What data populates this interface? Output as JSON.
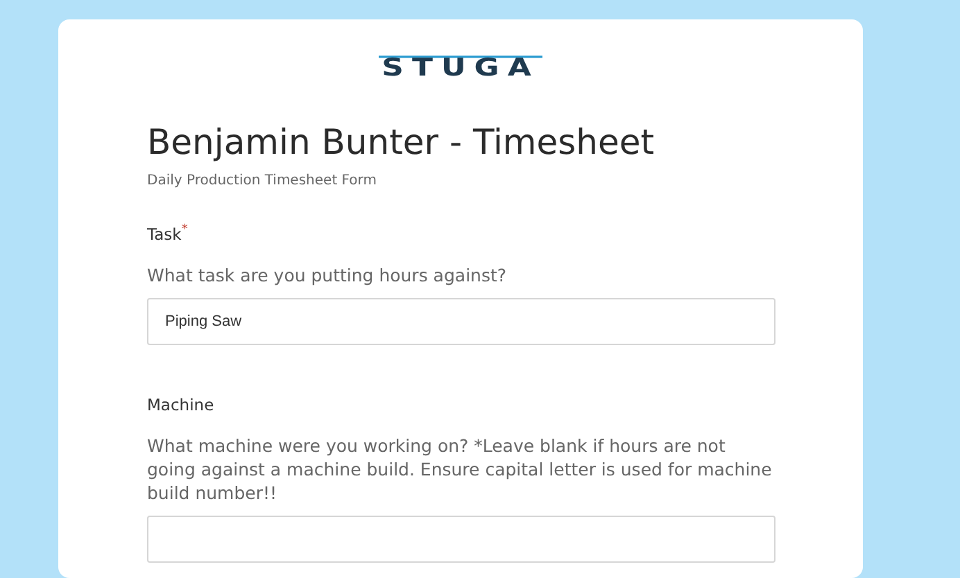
{
  "logo": {
    "text": "STUGA"
  },
  "title": "Benjamin Bunter - Timesheet",
  "subtitle": "Daily Production Timesheet Form",
  "questions": [
    {
      "label": "Task",
      "required_mark": "*",
      "description": "What task are you putting hours against?",
      "value": "Piping Saw"
    },
    {
      "label": "Machine",
      "description": "What machine were you working on? *Leave blank if hours are not going against a machine build. Ensure capital letter is used for machine build number!!"
    }
  ]
}
